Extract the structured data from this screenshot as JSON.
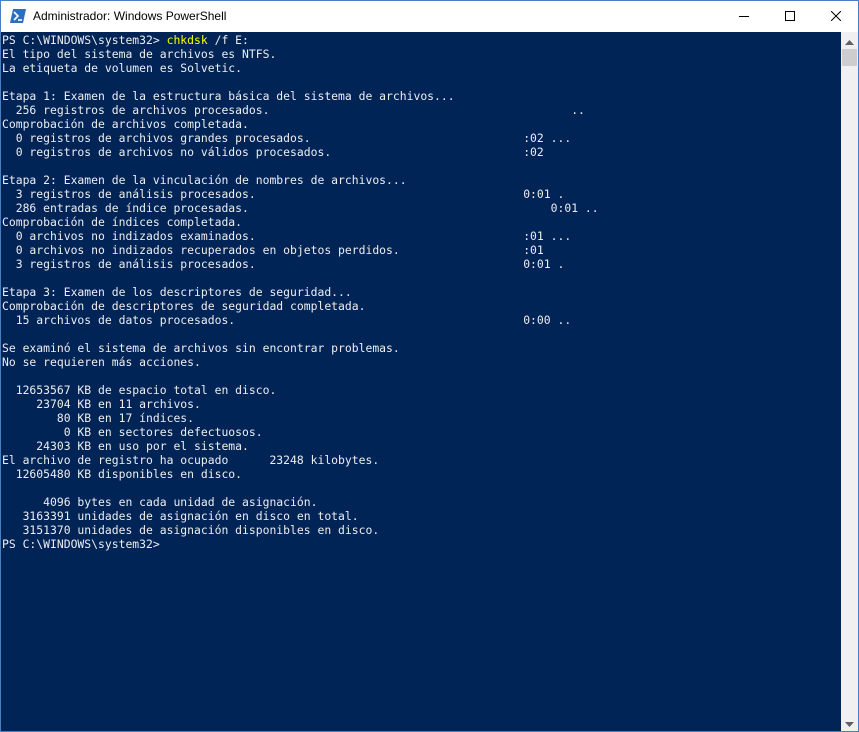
{
  "window": {
    "title": "Administrador: Windows PowerShell",
    "icon": "powershell-icon",
    "controls": {
      "minimize": "minimize-icon",
      "maximize": "maximize-icon",
      "close": "close-icon"
    }
  },
  "console": {
    "prompt1": "PS C:\\WINDOWS\\system32> ",
    "command": "chkdsk",
    "args": " /f E:",
    "output": "El tipo del sistema de archivos es NTFS.\nLa etiqueta de volumen es Solvetic.\n\nEtapa 1: Examen de la estructura básica del sistema de archivos...\n  256 registros de archivos procesados.                                            ..\nComprobación de archivos completada.\n  0 registros de archivos grandes procesados.                               :02 ...\n  0 registros de archivos no válidos procesados.                            :02\n\nEtapa 2: Examen de la vinculación de nombres de archivos...\n  3 registros de análisis procesados.                                       0:01 .\n  286 entradas de índice procesadas.                                            0:01 ..\nComprobación de índices completada.\n  0 archivos no indizados examinados.                                       :01 ...\n  0 archivos no indizados recuperados en objetos perdidos.                  :01\n  3 registros de análisis procesados.                                       0:01 .\n\nEtapa 3: Examen de los descriptores de seguridad...\nComprobación de descriptores de seguridad completada.\n  15 archivos de datos procesados.                                          0:00 ..\n\nSe examinó el sistema de archivos sin encontrar problemas.\nNo se requieren más acciones.\n\n  12653567 KB de espacio total en disco.\n     23704 KB en 11 archivos.\n        80 KB en 17 índices.\n         0 KB en sectores defectuosos.\n     24303 KB en uso por el sistema.\nEl archivo de registro ha ocupado      23248 kilobytes.\n  12605480 KB disponibles en disco.\n\n      4096 bytes en cada unidad de asignación.\n   3163391 unidades de asignación en disco en total.\n   3151370 unidades de asignación disponibles en disco.",
    "prompt2": "PS C:\\WINDOWS\\system32>"
  },
  "scrollbar": {
    "up": "scroll-up-arrow-icon",
    "down": "scroll-down-arrow-icon"
  },
  "colors": {
    "background": "#012456",
    "text": "#eeedf0",
    "command": "#ffff00"
  }
}
